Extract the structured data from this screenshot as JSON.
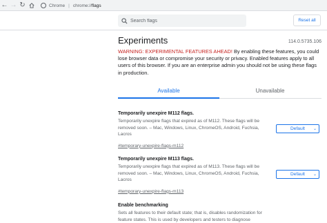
{
  "browser": {
    "tab_label": "Chrome",
    "url_scheme": "chrome://",
    "url_path": "flags"
  },
  "header": {
    "search_placeholder": "Search flags",
    "reset_label": "Reset all"
  },
  "main": {
    "title": "Experiments",
    "version": "114.0.5735.106",
    "warning_prefix": "WARNING: EXPERIMENTAL FEATURES AHEAD!",
    "warning_text": " By enabling these features, you could lose browser data or compromise your security or privacy. Enabled features apply to all users of this browser. If you are an enterprise admin you should not be using these flags in production.",
    "tabs": [
      {
        "label": "Available",
        "active": true
      },
      {
        "label": "Unavailable",
        "active": false
      }
    ],
    "flags": [
      {
        "name": "Temporarily unexpire M112 flags.",
        "description": "Temporarily unexpire flags that expired as of M112. These flags will be removed soon. – Mac, Windows, Linux, ChromeOS, Android, Fuchsia, Lacros",
        "link": "#temporary-unexpire-flags-m112",
        "value": "Default"
      },
      {
        "name": "Temporarily unexpire M113 flags.",
        "description": "Temporarily unexpire flags that expired as of M113. These flags will be removed soon. – Mac, Windows, Linux, ChromeOS, Android, Fuchsia, Lacros",
        "link": "#temporary-unexpire-flags-m113",
        "value": "Default"
      },
      {
        "name": "Enable benchmarking",
        "description": "Sets all features to their default state; that is, disables randomization for feature states. This is used by developers and testers to diagnose",
        "link": "",
        "value": ""
      }
    ]
  }
}
